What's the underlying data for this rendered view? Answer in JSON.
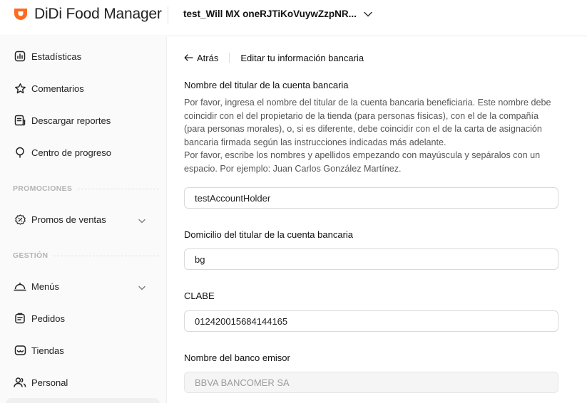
{
  "header": {
    "brand_prefix": "DiDi",
    "brand_suffix": "Food Manager",
    "store_name": "test_Will MX oneRJTiKoVuywZzpNR...",
    "brand_color": "#FF6A1F"
  },
  "sidebar": {
    "items": [
      {
        "label": "Estadísticas",
        "icon": "bar-chart-icon"
      },
      {
        "label": "Comentarios",
        "icon": "star-icon"
      },
      {
        "label": "Descargar reportes",
        "icon": "report-download-icon"
      },
      {
        "label": "Centro de progreso",
        "icon": "pin-icon"
      }
    ],
    "section_promos": "PROMOCIONES",
    "promos": [
      {
        "label": "Promos de ventas",
        "icon": "percent-badge-icon"
      }
    ],
    "section_gestion": "GESTIÓN",
    "gestion": [
      {
        "label": "Menús",
        "icon": "cloche-icon"
      },
      {
        "label": "Pedidos",
        "icon": "clipboard-icon"
      },
      {
        "label": "Tiendas",
        "icon": "store-icon"
      },
      {
        "label": "Personal",
        "icon": "people-icon"
      }
    ]
  },
  "main": {
    "back_label": "Atrás",
    "page_title": "Editar tu información bancaria",
    "holder_label": "Nombre del titular de la cuenta bancaria",
    "holder_desc_1": "Por favor, ingresa el nombre del titular de la cuenta bancaria beneficiaria. Este nombre debe coincidir con el del propietario de la tienda (para personas físicas), con el de la compañía (para personas morales), o, si es diferente, debe coincidir con el de la carta de asignación bancaria firmada según las instrucciones indicadas más adelante.",
    "holder_desc_2": "Por favor, escribe los nombres y apellidos empezando con mayúscula y sepáralos con un espacio. Por ejemplo: Juan Carlos González Martínez.",
    "holder_value": "testAccountHolder",
    "address_label": "Domicilio del titular de la cuenta bancaria",
    "address_value": "bg",
    "clabe_label": "CLABE",
    "clabe_value": "012420015684144165",
    "bank_label": "Nombre del banco emisor",
    "bank_value": "BBVA BANCOMER SA"
  }
}
